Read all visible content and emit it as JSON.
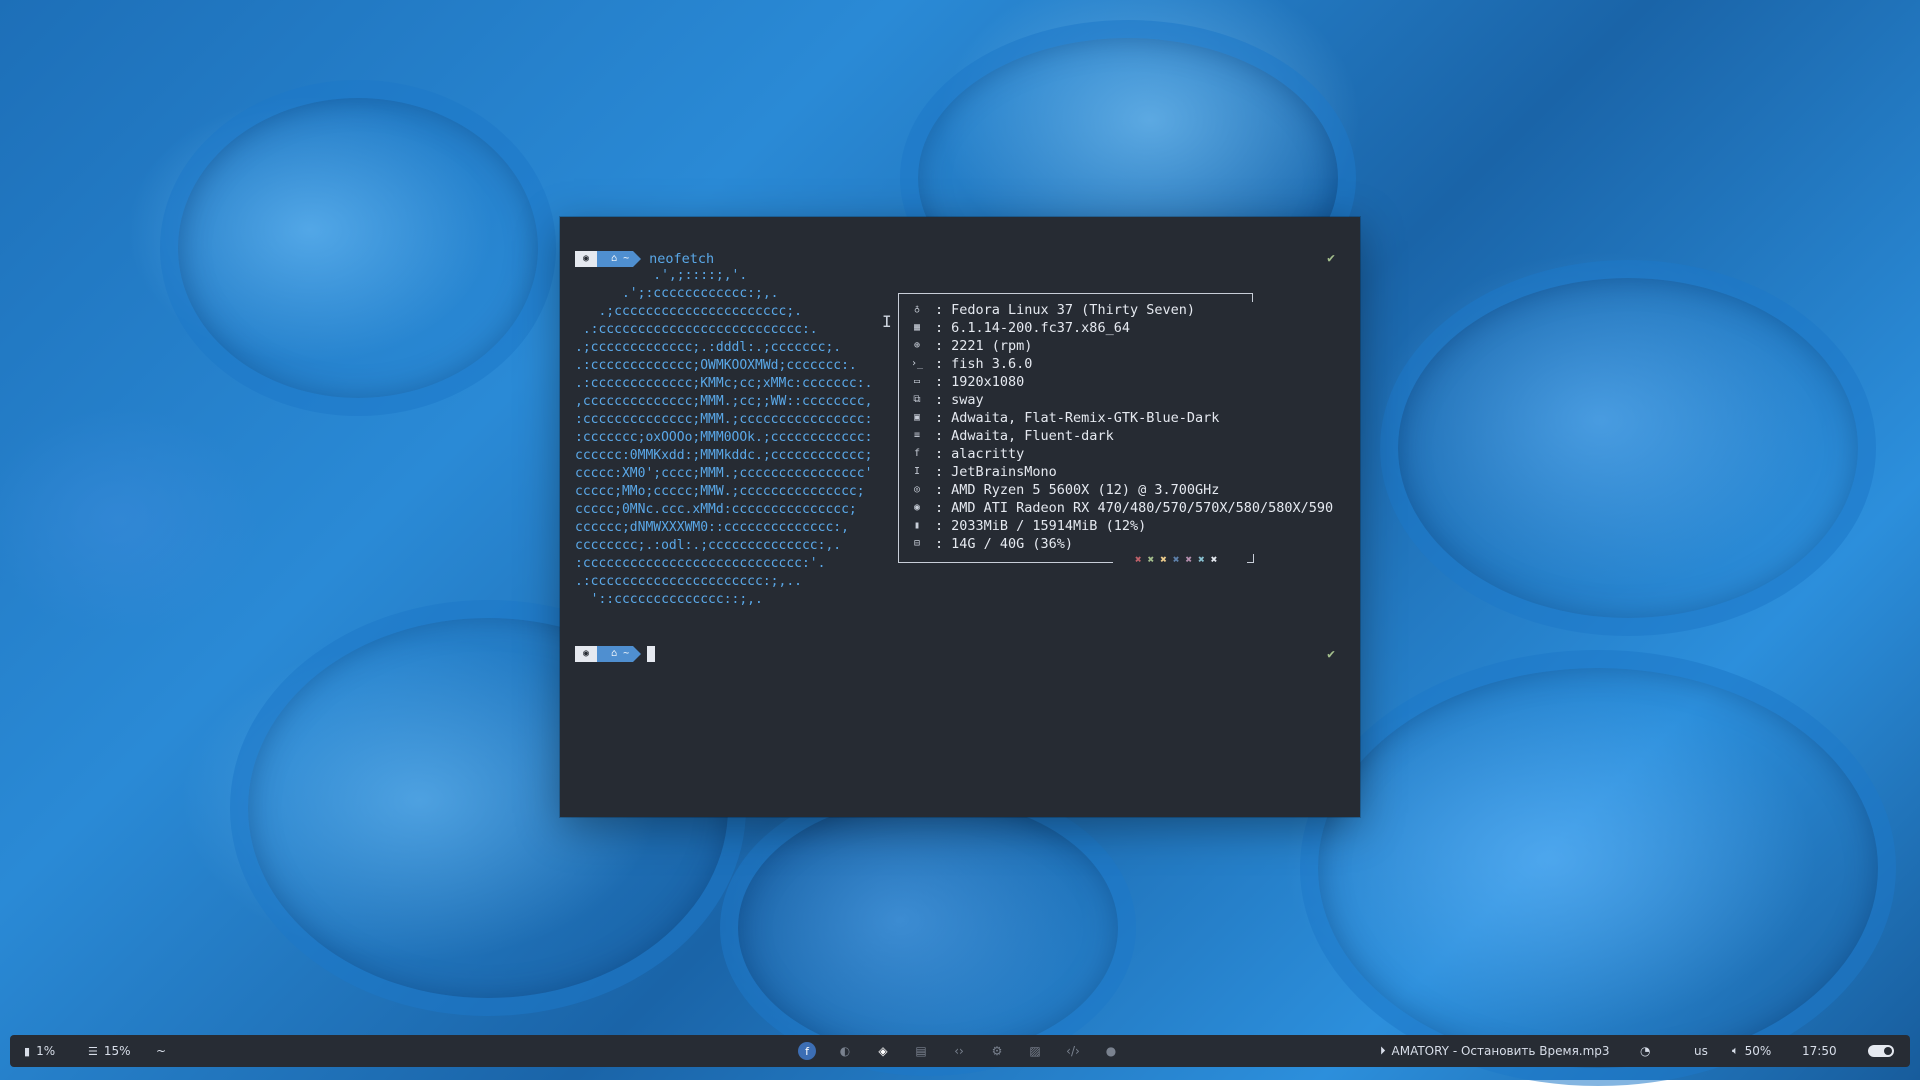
{
  "colors": {
    "terminal_bg": "#262b33",
    "accent_blue": "#5aa8e8",
    "prompt_dir_bg": "#4f8fd0",
    "success_green": "#a3be8c",
    "bar_bg": "#272c34",
    "swatch_colors": [
      "#bf616a",
      "#a3be8c",
      "#ebcb8b",
      "#5e81ac",
      "#b48ead",
      "#88c0d0",
      "#e5e9f0"
    ]
  },
  "terminal": {
    "prompt1": {
      "os_icon": "fedora-icon",
      "dir_home_icon": "home-icon",
      "dir": "~",
      "command": "neofetch",
      "status": "✔"
    },
    "ascii_art": "          .',;::::;,'.\n      .';:cccccccccccc:;,.\n   .;cccccccccccccccccccccc;.\n .:cccccccccccccccccccccccccc:.\n.;ccccccccccccc;.:dddl:.;ccccccc;.\n.:ccccccccccccc;OWMKOOXMWd;ccccccc:.\n.:ccccccccccccc;KMMc;cc;xMMc:ccccccc:.\n,cccccccccccccc;MMM.;cc;;WW::cccccccc,\n:cccccccccccccc;MMM.;cccccccccccccccc:\n:ccccccc;oxOOOo;MMM0OOk.;cccccccccccc:\ncccccc:0MMKxdd:;MMMkddc.;cccccccccccc;\nccccc:XM0';cccc;MMM.;cccccccccccccccc'\nccccc;MMo;ccccc;MMW.;ccccccccccccccc;\nccccc;0MNc.ccc.xMMd:ccccccccccccccc;\ncccccc;dNMWXXXWM0::cccccccccccccc:,\ncccccccc;.:odl:.;cccccccccccccc:,.\n:cccccccccccccccccccccccccccc:'.\n.:cccccccccccccccccccccc:;,..\n  '::cccccccccccccc::;,.",
    "info": [
      {
        "icon": "fedora-icon",
        "glyph": "♁",
        "value": "Fedora Linux 37 (Thirty Seven)"
      },
      {
        "icon": "kernel-icon",
        "glyph": "▦",
        "value": "6.1.14-200.fc37.x86_64"
      },
      {
        "icon": "package-icon",
        "glyph": "⊕",
        "value": "2221 (rpm)"
      },
      {
        "icon": "shell-icon",
        "glyph": "›_",
        "value": "fish 3.6.0"
      },
      {
        "icon": "display-icon",
        "glyph": "▭",
        "value": "1920x1080"
      },
      {
        "icon": "window-manager-icon",
        "glyph": "⧉",
        "value": "sway"
      },
      {
        "icon": "theme-icon",
        "glyph": "▣",
        "value": "Adwaita, Flat-Remix-GTK-Blue-Dark"
      },
      {
        "icon": "icons-icon",
        "glyph": "≡",
        "value": "Adwaita, Fluent-dark"
      },
      {
        "icon": "terminal-icon",
        "glyph": "f",
        "value": "alacritty"
      },
      {
        "icon": "font-icon",
        "glyph": "I",
        "value": "JetBrainsMono"
      },
      {
        "icon": "cpu-icon",
        "glyph": "◎",
        "value": "AMD Ryzen 5 5600X (12) @ 3.700GHz"
      },
      {
        "icon": "gpu-icon",
        "glyph": "◉",
        "value": "AMD ATI Radeon RX 470/480/570/570X/580/580X/590"
      },
      {
        "icon": "memory-icon",
        "glyph": "▮",
        "value": "2033MiB / 15914MiB (12%)"
      },
      {
        "icon": "disk-icon",
        "glyph": "⊟",
        "value": "14G / 40G (36%)"
      }
    ],
    "separator": ":",
    "swatch_glyph": "✖",
    "prompt2": {
      "os_icon": "fedora-icon",
      "dir_home_icon": "home-icon",
      "dir": "~",
      "status": "✔"
    }
  },
  "bar": {
    "left": {
      "cpu_icon": "cpu-icon",
      "cpu_value": "1%",
      "memory_icon": "memory-icon",
      "memory_value": "15%",
      "dir": "~"
    },
    "workspaces": [
      {
        "icon": "fedora-workspace-icon",
        "glyph": "f",
        "active": true
      },
      {
        "icon": "firefox-icon",
        "glyph": "◐",
        "active": false
      },
      {
        "icon": "compass-icon",
        "glyph": "◈",
        "active": false
      },
      {
        "icon": "files-icon",
        "glyph": "▤",
        "active": false
      },
      {
        "icon": "code-icon",
        "glyph": "‹›",
        "active": false
      },
      {
        "icon": "settings-icon",
        "glyph": "⚙",
        "active": false
      },
      {
        "icon": "image-icon",
        "glyph": "▨",
        "active": false
      },
      {
        "icon": "code-alt-icon",
        "glyph": "‹/›",
        "active": false
      },
      {
        "icon": "circle-icon",
        "glyph": "●",
        "active": false
      }
    ],
    "right": {
      "media_icon": "play-icon",
      "media_text": "AMATORY - Остановить Время.mp3",
      "night_icon": "moon-icon",
      "keyboard_layout": "us",
      "volume_icon": "volume-icon",
      "volume_value": "50%",
      "clock": "17:50",
      "toggle_icon": "toggle-icon"
    }
  }
}
